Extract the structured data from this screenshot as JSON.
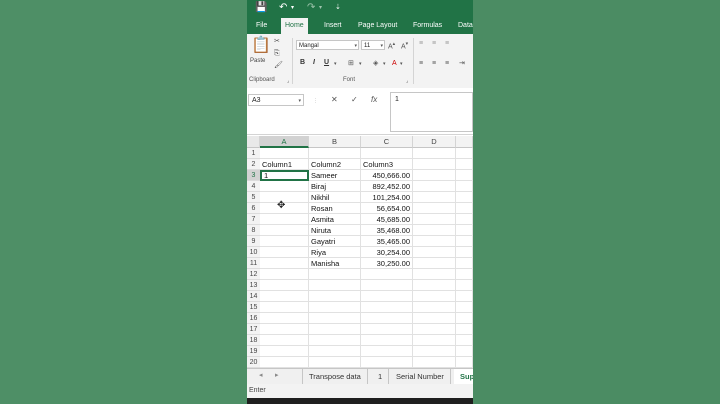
{
  "titlebar": {
    "save_icon": "save-icon",
    "undo_icon": "undo-icon",
    "redo_icon": "redo-icon",
    "customize_icon": "customize-icon"
  },
  "ribbon_tabs": [
    "File",
    "Home",
    "Insert",
    "Page Layout",
    "Formulas",
    "Data"
  ],
  "active_tab": "Home",
  "clipboard": {
    "paste_label": "Paste",
    "group_label": "Clipboard"
  },
  "font": {
    "name": "Mangal",
    "size": "11",
    "group_label": "Font",
    "bold": "B",
    "italic": "I",
    "underline": "U"
  },
  "formula_bar": {
    "name_box": "A3",
    "cancel": "✕",
    "enter": "✓",
    "fx": "fx",
    "value": "1"
  },
  "columns": [
    "A",
    "B",
    "C",
    "D"
  ],
  "rows": [
    "1",
    "2",
    "3",
    "4",
    "5",
    "6",
    "7",
    "8",
    "9",
    "10",
    "11",
    "12",
    "13",
    "14",
    "15",
    "16",
    "17",
    "18",
    "19",
    "20"
  ],
  "cells": {
    "headers": {
      "A2": "Column1",
      "B2": "Column2",
      "C2": "Column3"
    },
    "A3": "1",
    "names": [
      "Sameer",
      "Biraj",
      "Nikhil",
      "Rosan",
      "Asmita",
      "Niruta",
      "Gayatri",
      "Riya",
      "Manisha"
    ],
    "amounts": [
      "450,666.00",
      "892,452.00",
      "101,254.00",
      "56,654.00",
      "45,685.00",
      "35,468.00",
      "35,465.00",
      "30,254.00",
      "30,250.00"
    ]
  },
  "sheet_tabs": [
    "Transpose data",
    "1",
    "Serial Number",
    "Sup"
  ],
  "active_sheet": "Sup",
  "status": "Enter",
  "colors": {
    "accent": "#217346",
    "background": "#4a8c62"
  }
}
